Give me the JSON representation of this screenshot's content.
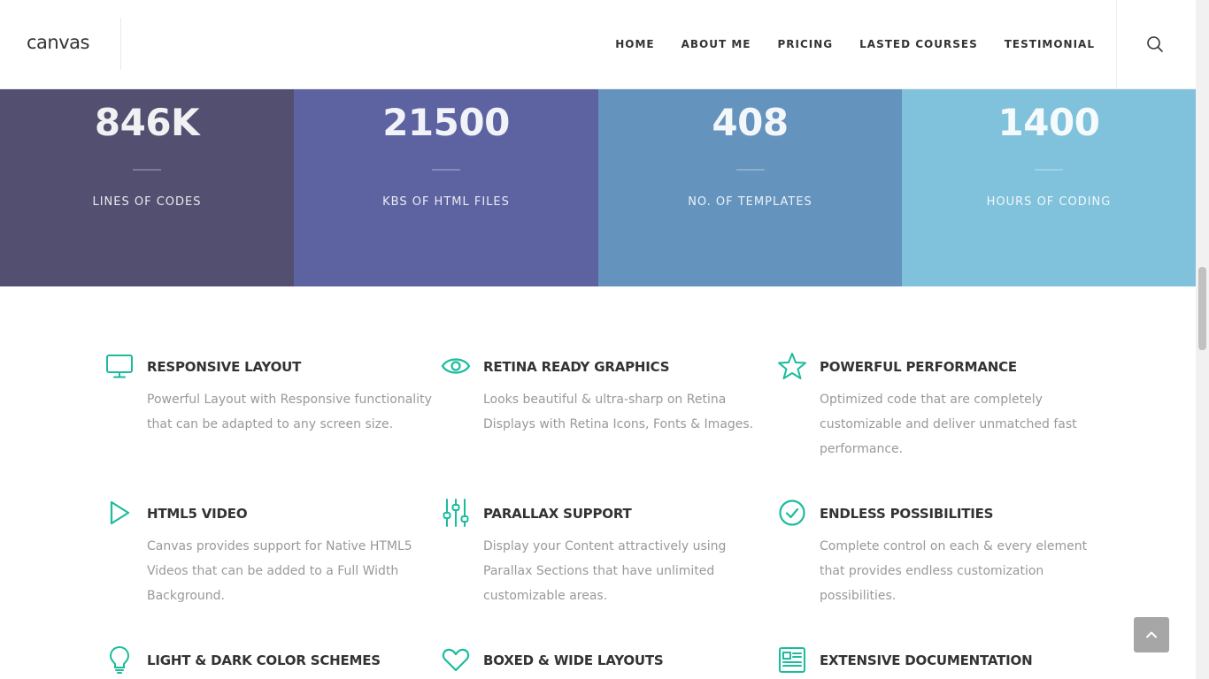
{
  "header": {
    "logo": "canvas",
    "nav": [
      "HOME",
      "ABOUT ME",
      "PRICING",
      "LASTED COURSES",
      "TESTIMONIAL"
    ],
    "search_icon": "search-icon"
  },
  "stats": [
    {
      "value": "846K",
      "label": "LINES OF CODES",
      "color": "#524f70"
    },
    {
      "value": "21500",
      "label": "KBS OF HTML FILES",
      "color": "#5c63a0"
    },
    {
      "value": "408",
      "label": "NO. OF TEMPLATES",
      "color": "#6493bd"
    },
    {
      "value": "1400",
      "label": "HOURS OF CODING",
      "color": "#80c2db"
    }
  ],
  "accent_color": "#1abc9c",
  "features": [
    {
      "icon": "monitor-icon",
      "title": "RESPONSIVE LAYOUT",
      "desc": "Powerful Layout with Responsive functionality that can be adapted to any screen size."
    },
    {
      "icon": "eye-icon",
      "title": "RETINA READY GRAPHICS",
      "desc": "Looks beautiful & ultra-sharp on Retina Displays with Retina Icons, Fonts & Images."
    },
    {
      "icon": "star-icon",
      "title": "POWERFUL PERFORMANCE",
      "desc": "Optimized code that are completely customizable and deliver unmatched fast performance."
    },
    {
      "icon": "play-icon",
      "title": "HTML5 VIDEO",
      "desc": "Canvas provides support for Native HTML5 Videos that can be added to a Full Width Background."
    },
    {
      "icon": "sliders-icon",
      "title": "PARALLAX SUPPORT",
      "desc": "Display your Content attractively using Parallax Sections that have unlimited customizable areas."
    },
    {
      "icon": "check-circle-icon",
      "title": "ENDLESS POSSIBILITIES",
      "desc": "Complete control on each & every element that provides endless customization possibilities."
    },
    {
      "icon": "lightbulb-icon",
      "title": "LIGHT & DARK COLOR SCHEMES",
      "desc": ""
    },
    {
      "icon": "heart-icon",
      "title": "BOXED & WIDE LAYOUTS",
      "desc": ""
    },
    {
      "icon": "document-icon",
      "title": "EXTENSIVE DOCUMENTATION",
      "desc": ""
    }
  ],
  "back_to_top_icon": "chevron-up-icon"
}
